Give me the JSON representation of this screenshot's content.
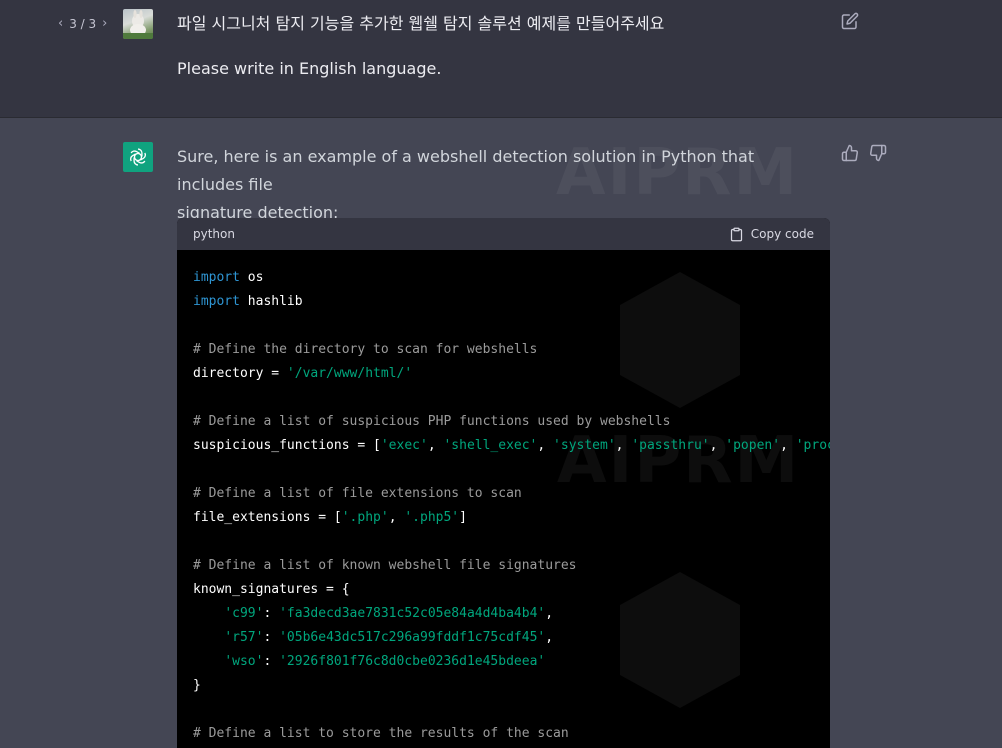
{
  "user_message": {
    "pager": {
      "text": "3 / 3",
      "prev_icon": "chevron-left-icon",
      "next_icon": "chevron-right-icon"
    },
    "prompt_korean": "파일 시그니처 탐지 기능을 추가한 웹쉘 탐지 솔루션 예제를 만들어주세요",
    "prompt_english": "Please write in English language.",
    "edit_icon": "edit-icon"
  },
  "assistant_message": {
    "intro_line1": "Sure, here is an example of a webshell detection solution in Python that includes file",
    "intro_line2": "signature detection:",
    "thumbs_up_icon": "thumbs-up-icon",
    "thumbs_down_icon": "thumbs-down-icon",
    "watermark_text": "AIPRM",
    "code": {
      "language": "python",
      "copy_label": "Copy code",
      "lines": [
        [
          {
            "t": "import",
            "c": "kw"
          },
          {
            "t": " os",
            "c": ""
          }
        ],
        [
          {
            "t": "import",
            "c": "kw"
          },
          {
            "t": " hashlib",
            "c": ""
          }
        ],
        [],
        [
          {
            "t": "# Define the directory to scan for webshells",
            "c": "cm"
          }
        ],
        [
          {
            "t": "directory = ",
            "c": ""
          },
          {
            "t": "'/var/www/html/'",
            "c": "str"
          }
        ],
        [],
        [
          {
            "t": "# Define a list of suspicious PHP functions used by webshells",
            "c": "cm"
          }
        ],
        [
          {
            "t": "suspicious_functions = [",
            "c": ""
          },
          {
            "t": "'exec'",
            "c": "str"
          },
          {
            "t": ", ",
            "c": ""
          },
          {
            "t": "'shell_exec'",
            "c": "str"
          },
          {
            "t": ", ",
            "c": ""
          },
          {
            "t": "'system'",
            "c": "str"
          },
          {
            "t": ", ",
            "c": ""
          },
          {
            "t": "'passthru'",
            "c": "str"
          },
          {
            "t": ", ",
            "c": ""
          },
          {
            "t": "'popen'",
            "c": "str"
          },
          {
            "t": ", ",
            "c": ""
          },
          {
            "t": "'proc_open'",
            "c": "str"
          },
          {
            "t": "]",
            "c": ""
          }
        ],
        [],
        [
          {
            "t": "# Define a list of file extensions to scan",
            "c": "cm"
          }
        ],
        [
          {
            "t": "file_extensions = [",
            "c": ""
          },
          {
            "t": "'.php'",
            "c": "str"
          },
          {
            "t": ", ",
            "c": ""
          },
          {
            "t": "'.php5'",
            "c": "str"
          },
          {
            "t": "]",
            "c": ""
          }
        ],
        [],
        [
          {
            "t": "# Define a list of known webshell file signatures",
            "c": "cm"
          }
        ],
        [
          {
            "t": "known_signatures = {",
            "c": ""
          }
        ],
        [
          {
            "t": "    ",
            "c": ""
          },
          {
            "t": "'c99'",
            "c": "str"
          },
          {
            "t": ": ",
            "c": ""
          },
          {
            "t": "'fa3decd3ae7831c52c05e84a4d4ba4b4'",
            "c": "str"
          },
          {
            "t": ",",
            "c": ""
          }
        ],
        [
          {
            "t": "    ",
            "c": ""
          },
          {
            "t": "'r57'",
            "c": "str"
          },
          {
            "t": ": ",
            "c": ""
          },
          {
            "t": "'05b6e43dc517c296a99fddf1c75cdf45'",
            "c": "str"
          },
          {
            "t": ",",
            "c": ""
          }
        ],
        [
          {
            "t": "    ",
            "c": ""
          },
          {
            "t": "'wso'",
            "c": "str"
          },
          {
            "t": ": ",
            "c": ""
          },
          {
            "t": "'2926f801f76c8d0cbe0236d1e45bdeea'",
            "c": "str"
          }
        ],
        [
          {
            "t": "}",
            "c": ""
          }
        ],
        [],
        [
          {
            "t": "# Define a list to store the results of the scan",
            "c": "cm"
          }
        ]
      ]
    }
  },
  "colors": {
    "user_bg": "#343541",
    "assistant_bg": "#444654",
    "bot_avatar": "#10a37f",
    "keyword": "#2e95d3",
    "string": "#00a67d",
    "comment": "#9b9b9b"
  }
}
